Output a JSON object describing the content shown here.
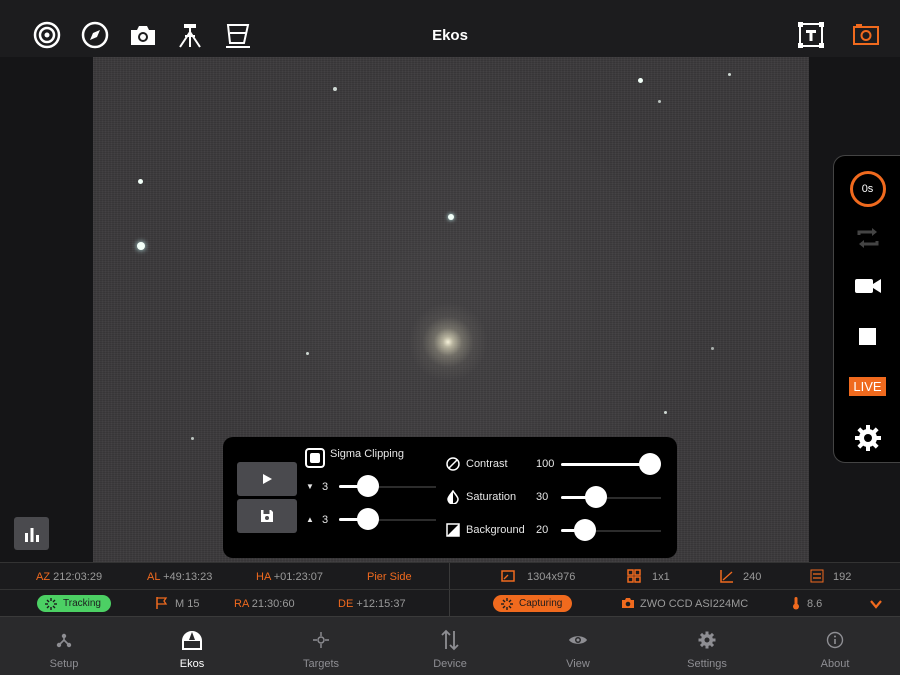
{
  "app": {
    "title": "Ekos"
  },
  "toolbar": {
    "left_icons": [
      "target-icon",
      "compass-icon",
      "camera-icon",
      "tripod-mount-icon",
      "filter-wheel-icon"
    ],
    "right_icons": [
      "text-frame-icon",
      "camera-frame-icon"
    ]
  },
  "rail": {
    "timer_label": "0s",
    "live_label": "LIVE",
    "icons": [
      "loop-icon",
      "video-camera-icon",
      "stop-icon",
      "settings-gear-icon"
    ]
  },
  "panel": {
    "sigma_label": "Sigma Clipping",
    "sigma_checked": true,
    "lower_sigma": "3",
    "upper_sigma": "3",
    "lower_sigma_fraction": 0.3,
    "upper_sigma_fraction": 0.3,
    "contrast": {
      "label": "Contrast",
      "value": "100",
      "fraction": 1.0
    },
    "saturation": {
      "label": "Saturation",
      "value": "30",
      "fraction": 0.3
    },
    "background": {
      "label": "Background",
      "value": "20",
      "fraction": 0.2
    }
  },
  "status": {
    "az": {
      "label": "AZ",
      "value": "212:03:29"
    },
    "al": {
      "label": "AL",
      "value": "+49:13:23"
    },
    "ha": {
      "label": "HA",
      "value": "+01:23:07"
    },
    "pier_side": "Pier Side",
    "resolution": "1304x976",
    "binning": "1x1",
    "gain": "240",
    "offset": "192",
    "mount_state": "Tracking",
    "target": "M 15",
    "ra": {
      "label": "RA",
      "value": "21:30:60"
    },
    "de": {
      "label": "DE",
      "value": "+12:15:37"
    },
    "capture_state": "Capturing",
    "camera": "ZWO CCD ASI224MC",
    "temperature": "8.6"
  },
  "tabs": [
    {
      "label": "Setup",
      "icon": "setup-icon",
      "active": false
    },
    {
      "label": "Ekos",
      "icon": "observatory-dome-icon",
      "active": true
    },
    {
      "label": "Targets",
      "icon": "targets-icon",
      "active": false
    },
    {
      "label": "Device",
      "icon": "device-arrows-icon",
      "active": false
    },
    {
      "label": "View",
      "icon": "eye-icon",
      "active": false
    },
    {
      "label": "Settings",
      "icon": "gear-icon",
      "active": false
    },
    {
      "label": "About",
      "icon": "info-icon",
      "active": false
    }
  ],
  "colors": {
    "accent": "#f06a1e",
    "tracking_green": "#4cd064",
    "background": "#1c1c1e"
  }
}
